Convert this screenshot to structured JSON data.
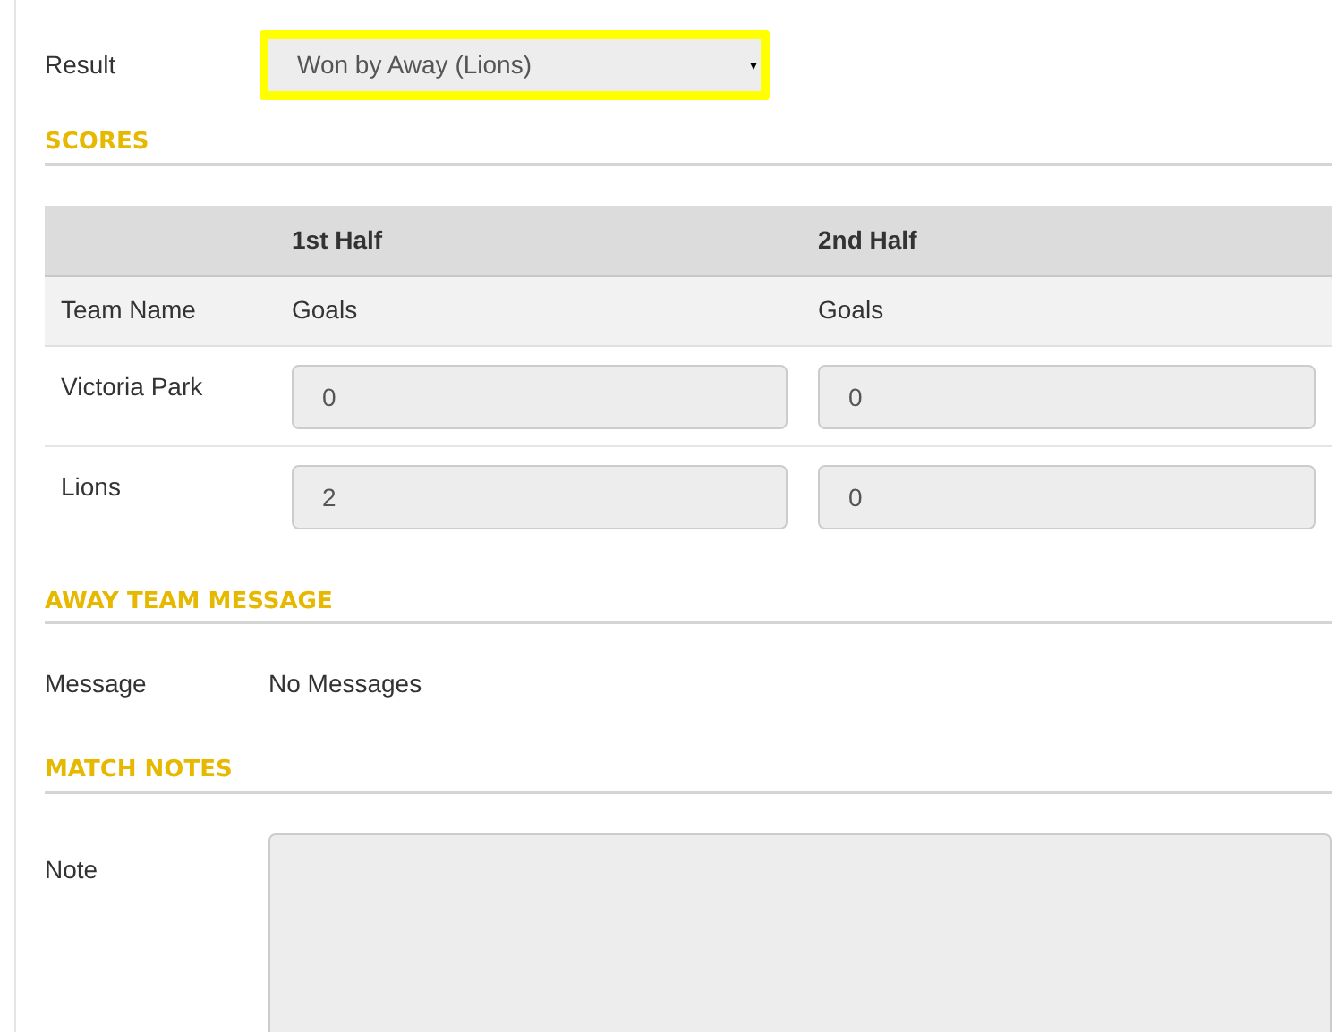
{
  "result": {
    "label": "Result",
    "value": "Won by Away (Lions)",
    "highlighted": true
  },
  "scores": {
    "heading": "SCORES",
    "columns": [
      "",
      "1st Half",
      "2nd Half"
    ],
    "subheader": [
      "Team Name",
      "Goals",
      "Goals"
    ],
    "rows": [
      {
        "team": "Victoria Park",
        "values": [
          "0",
          "0"
        ]
      },
      {
        "team": "Lions",
        "values": [
          "2",
          "0"
        ]
      }
    ]
  },
  "away_team_message": {
    "heading": "AWAY TEAM MESSAGE",
    "label": "Message",
    "value": "No Messages"
  },
  "match_notes": {
    "heading": "MATCH NOTES",
    "label": "Note"
  }
}
